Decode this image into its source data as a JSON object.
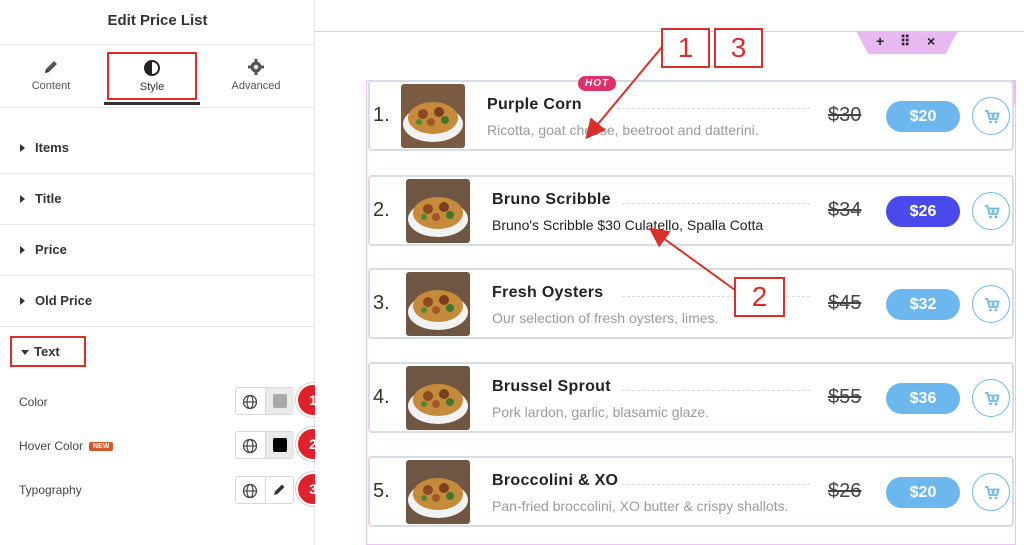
{
  "panel": {
    "title": "Edit Price List",
    "tabs": [
      {
        "label": "Content",
        "icon": "pencil-icon"
      },
      {
        "label": "Style",
        "icon": "half-circle-icon"
      },
      {
        "label": "Advanced",
        "icon": "gear-icon"
      }
    ],
    "active_tab": "Style",
    "sections": [
      "Items",
      "Title",
      "Price",
      "Old Price"
    ],
    "open_section": "Text",
    "controls": {
      "color": {
        "label": "Color",
        "swatch": "#a9a9a9"
      },
      "hover_color": {
        "label": "Hover Color",
        "badge": "NEW",
        "swatch": "#000000"
      },
      "typography": {
        "label": "Typography"
      }
    },
    "annotation_badges": [
      "1",
      "2",
      "3"
    ]
  },
  "canvas": {
    "section_handle_icons": [
      "+",
      "⠿",
      "×"
    ],
    "items": [
      {
        "number": "1.",
        "name": "Purple Corn",
        "badge": "HOT",
        "description": "Ricotta, goat cheese, beetroot and datterini.",
        "old_price": "$30",
        "price": "$20",
        "highlight": false
      },
      {
        "number": "2.",
        "name": "Bruno Scribble",
        "badge": "",
        "description": "Bruno's Scribble $30 Culatello, Spalla Cotta",
        "old_price": "$34",
        "price": "$26",
        "highlight": true
      },
      {
        "number": "3.",
        "name": "Fresh Oysters",
        "badge": "",
        "description": "Our selection of fresh oysters, limes.",
        "old_price": "$45",
        "price": "$32",
        "highlight": false
      },
      {
        "number": "4.",
        "name": "Brussel Sprout",
        "badge": "",
        "description": "Pork lardon, garlic, blasamic glaze.",
        "old_price": "$55",
        "price": "$36",
        "highlight": false
      },
      {
        "number": "5.",
        "name": "Broccolini & XO",
        "badge": "",
        "description": "Pan-fried broccolini, XO butter & crispy shallots.",
        "old_price": "$26",
        "price": "$20",
        "highlight": false
      }
    ],
    "callouts": [
      "1",
      "3",
      "2"
    ]
  },
  "colors": {
    "accent_red": "#d9302c",
    "price_blue": "#6cb8ee",
    "price_active": "#4a4aec",
    "hot_pink": "#e0306a",
    "editor_pink": "#e8b8f0"
  }
}
